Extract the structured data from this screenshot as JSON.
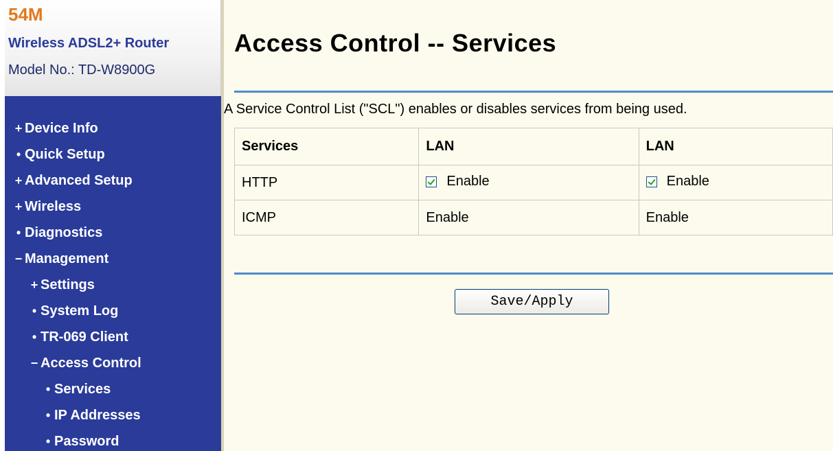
{
  "brand": {
    "speed": "54M",
    "product": "Wireless ADSL2+ Router",
    "model_label": "Model No.:",
    "model_value": "TD-W8900G"
  },
  "sidebar": {
    "items": [
      {
        "marker": "+",
        "label": "Device Info",
        "level": 0
      },
      {
        "marker": "•",
        "label": "Quick Setup",
        "level": 0
      },
      {
        "marker": "+",
        "label": "Advanced Setup",
        "level": 0
      },
      {
        "marker": "+",
        "label": "Wireless",
        "level": 0
      },
      {
        "marker": "•",
        "label": "Diagnostics",
        "level": 0
      },
      {
        "marker": "−",
        "label": "Management",
        "level": 0
      },
      {
        "marker": "+",
        "label": "Settings",
        "level": 1
      },
      {
        "marker": "•",
        "label": "System Log",
        "level": 1
      },
      {
        "marker": "•",
        "label": "TR-069 Client",
        "level": 1
      },
      {
        "marker": "−",
        "label": "Access Control",
        "level": 1
      },
      {
        "marker": "•",
        "label": "Services",
        "level": 2
      },
      {
        "marker": "•",
        "label": "IP Addresses",
        "level": 2
      },
      {
        "marker": "•",
        "label": "Password",
        "level": 2
      }
    ]
  },
  "main": {
    "title": "Access Control -- Services",
    "intro": "A Service Control List (\"SCL\") enables or disables services from being used.",
    "table": {
      "headers": [
        "Services",
        "LAN",
        "LAN"
      ],
      "rows": [
        {
          "service": "HTTP",
          "lan1": "Enable",
          "lan1_checked": true,
          "lan2": "Enable",
          "lan2_checked": true
        },
        {
          "service": "ICMP",
          "lan1": "Enable",
          "lan2": "Enable"
        }
      ]
    },
    "save_label": "Save/Apply"
  },
  "colors": {
    "sidebar_bg": "#2a3b9a",
    "content_bg": "#fcfbed",
    "rule": "#4c8cc8",
    "brand_orange": "#e4781c"
  }
}
